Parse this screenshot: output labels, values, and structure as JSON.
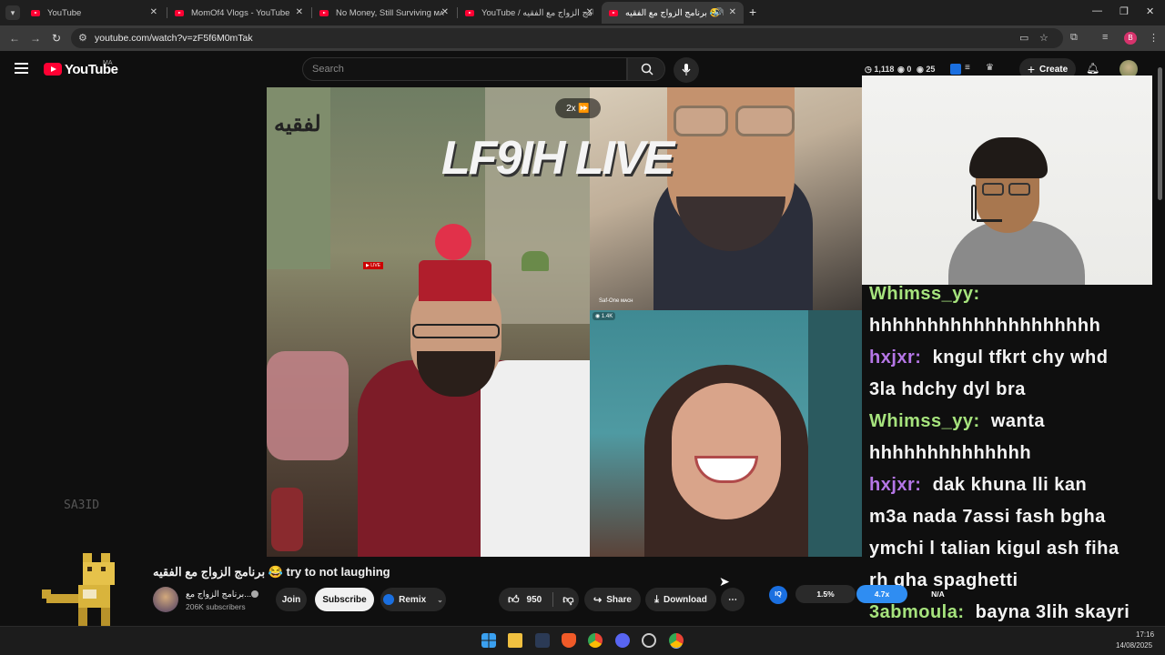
{
  "browser": {
    "tabs": [
      {
        "title": "YouTube",
        "active": false
      },
      {
        "title": "MomOf4 Vlogs - YouTube",
        "active": false
      },
      {
        "title": "No Money, Still Surviving ᴍᴀ - Y",
        "active": false
      },
      {
        "title": "YouTube / برنامج الزواج مع الفقيه",
        "active": false
      },
      {
        "title": "برنامج الزواج مع الفقيه 😂 Be",
        "active": true
      }
    ],
    "url": "youtube.com/watch?v=zF5f6M0mTak",
    "profile_letter": "B"
  },
  "youtube": {
    "logo_text": "YouTube",
    "country": "MA",
    "search_placeholder": "Search",
    "stats": {
      "views": "1,118",
      "zero": "0",
      "count": "25"
    },
    "create_label": "Create"
  },
  "video": {
    "title_overlay": "LF9IH LIVE",
    "speed": "2x ⏩",
    "cam_label": "Saf-One ᴍᴀᴄʜ",
    "viewers": "◉ 1.4K",
    "watermark": "لفقيه"
  },
  "chat": [
    {
      "user": "Whimss_yy:",
      "color": "green",
      "lines": [
        "hhhhhhhhhhhhhhhhhhhh"
      ]
    },
    {
      "user": "hxjxr:",
      "color": "purple",
      "lines": [
        "kngul tfkrt chy whd",
        "3la hdchy dyl bra"
      ]
    },
    {
      "user": "Whimss_yy:",
      "color": "green",
      "lines": [
        "wanta",
        "hhhhhhhhhhhhhh"
      ]
    },
    {
      "user": "hxjxr:",
      "color": "purple",
      "lines": [
        "dak khuna lli kan",
        "m3a nada 7assi fash bgha",
        "ymchi l talian kigul ash fiha",
        "rh gha spaghetti"
      ]
    },
    {
      "user": "3abmoula:",
      "color": "green",
      "lines": [
        "bayna 3lih skayri"
      ]
    }
  ],
  "sidebar": {
    "sa3id_text": "SA3ID"
  },
  "meta": {
    "title": "برنامج الزواج مع الفقيه 😂 try to not laughing",
    "channel_name": "برنامج الزواج مع...",
    "subscribers": "206K subscribers",
    "join_label": "Join",
    "subscribe_label": "Subscribe",
    "remix_label": "Remix",
    "likes": "950",
    "share_label": "Share",
    "download_label": "Download",
    "more_label": "⋯"
  },
  "iq_widget": {
    "icon": "IQ",
    "pct_a": "1.5%",
    "pct_b": "4.7x",
    "pct_c": "N/A"
  },
  "taskbar": {
    "time": "17:16",
    "date": "14/08/2025"
  },
  "colors": {
    "youtube_red": "#ff0033",
    "chat_green": "#a6e37d",
    "chat_purple": "#b576e6",
    "accent_blue": "#2f8df2"
  }
}
